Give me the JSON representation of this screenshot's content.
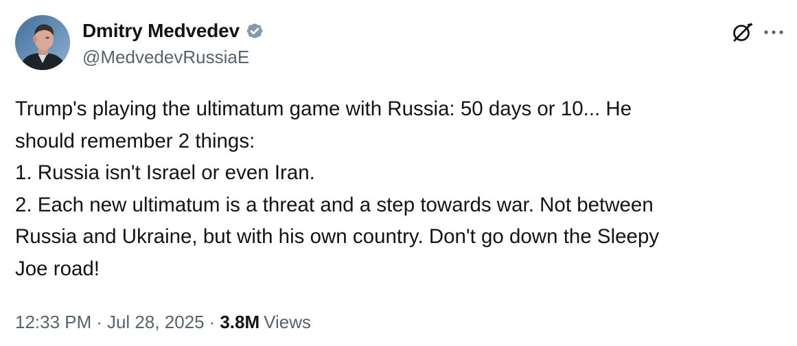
{
  "author": {
    "display_name": "Dmitry Medvedev",
    "handle": "@MedvedevRussiaE",
    "verified_color": "#829aab"
  },
  "header_actions": {
    "grok_icon": "grok-slash-circle-icon",
    "more_icon": "more-horizontal-icon"
  },
  "tweet": {
    "lines": [
      "Trump's playing the ultimatum game with Russia: 50 days or 10... He",
      "should remember 2 things:",
      "1. Russia isn't Israel or even Iran.",
      "2. Each new ultimatum is a threat and a step towards war. Not between",
      "Russia and Ukraine, but with his own country. Don't go down the Sleepy",
      "Joe road!"
    ]
  },
  "meta": {
    "time": "12:33 PM",
    "separator": "·",
    "date": "Jul 28, 2025",
    "views_count": "3.8M",
    "views_label": "Views"
  },
  "colors": {
    "text_primary": "#0f1419",
    "text_secondary": "#536471",
    "background": "#ffffff"
  }
}
